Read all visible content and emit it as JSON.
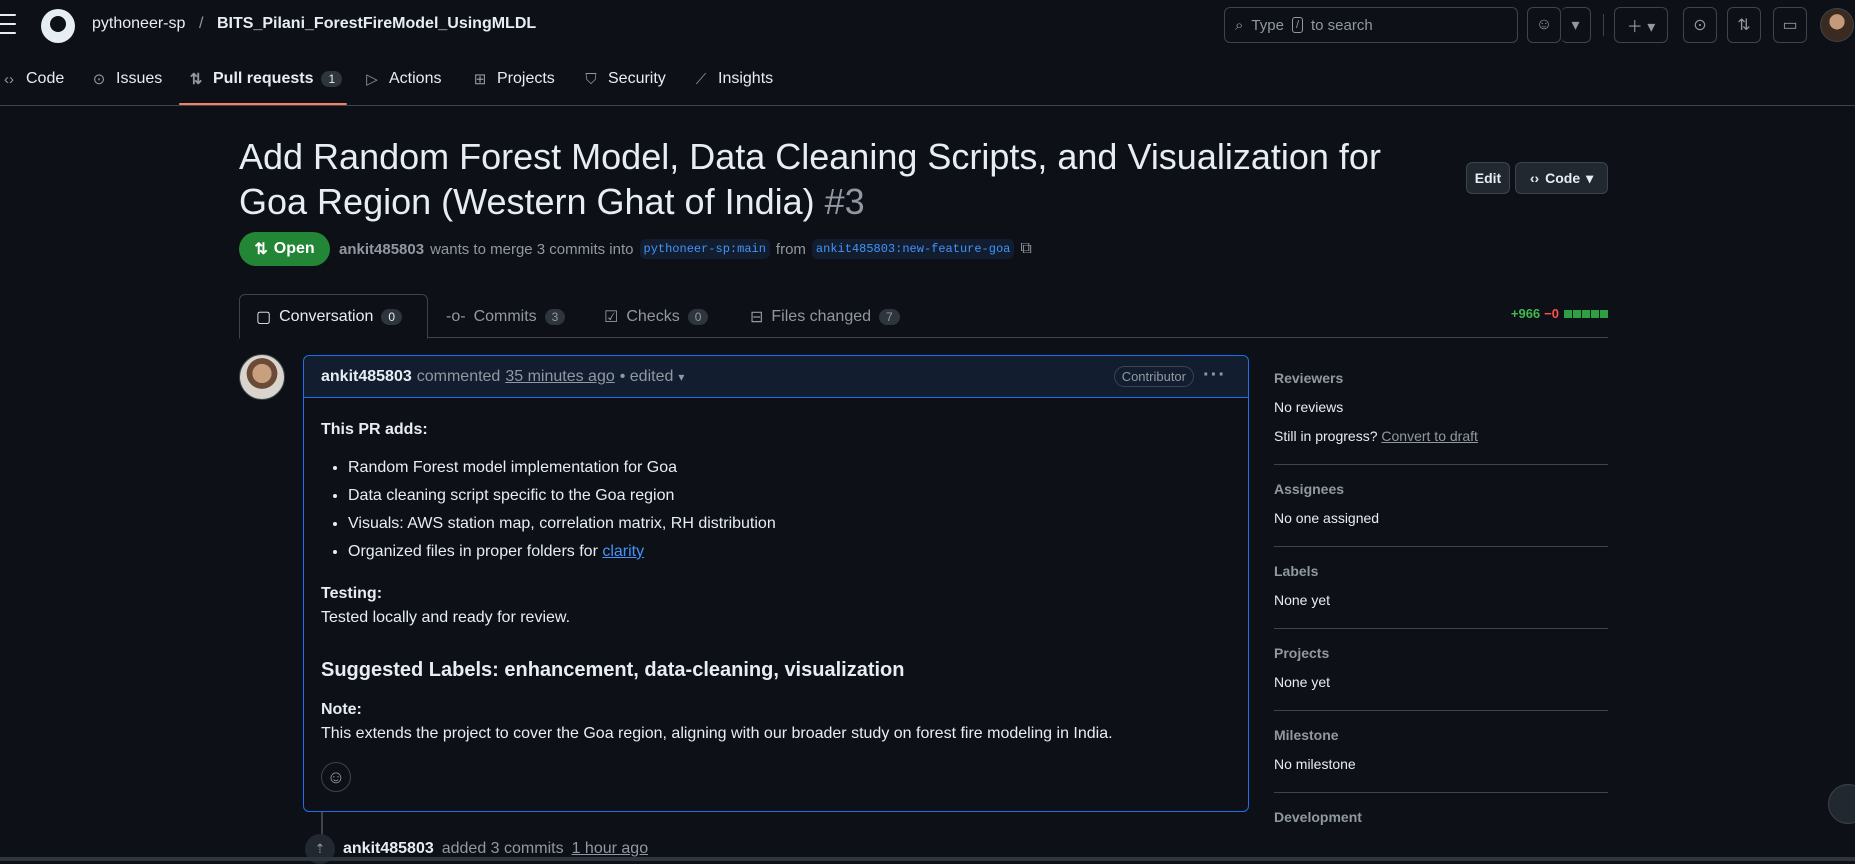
{
  "header": {
    "owner": "pythoneer-sp",
    "separator": "/",
    "repo": "BITS_Pilani_ForestFireModel_UsingMLDL",
    "search_prefix": "Type",
    "search_key": "/",
    "search_suffix": "to search"
  },
  "repo_nav": {
    "items": [
      {
        "label": "Code",
        "icon": "code-icon"
      },
      {
        "label": "Issues",
        "icon": "issue-icon"
      },
      {
        "label": "Pull requests",
        "icon": "pull-request-icon",
        "count": "1",
        "active": true
      },
      {
        "label": "Actions",
        "icon": "play-icon"
      },
      {
        "label": "Projects",
        "icon": "table-icon"
      },
      {
        "label": "Security",
        "icon": "shield-icon"
      },
      {
        "label": "Insights",
        "icon": "graph-icon"
      }
    ]
  },
  "pr": {
    "title": "Add Random Forest Model, Data Cleaning Scripts, and Visualization for Goa Region (Western Ghat of India)",
    "number": "#3",
    "state": "Open",
    "author": "ankit485803",
    "merge_text": "wants to merge 3 commits into",
    "base": "pythoneer-sp:main",
    "from_text": "from",
    "head": "ankit485803:new-feature-goa",
    "edit_label": "Edit",
    "code_label": "Code"
  },
  "tabs": [
    {
      "label": "Conversation",
      "count": "0",
      "icon": "comment-icon",
      "active": true
    },
    {
      "label": "Commits",
      "count": "3",
      "icon": "commit-icon"
    },
    {
      "label": "Checks",
      "count": "0",
      "icon": "checklist-icon"
    },
    {
      "label": "Files changed",
      "count": "7",
      "icon": "file-diff-icon"
    }
  ],
  "diffstat": {
    "additions": "+966",
    "deletions": "−0"
  },
  "comment": {
    "author": "ankit485803",
    "action": "commented",
    "time": "35 minutes ago",
    "edited": "• edited",
    "badge": "Contributor",
    "intro": "This PR adds:",
    "bullets": [
      "Random Forest model implementation for Goa",
      "Data cleaning script specific to the Goa region",
      "Visuals: AWS station map, correlation matrix, RH distribution",
      "Organized files in proper folders for "
    ],
    "bullet_link": "clarity",
    "testing_label": "Testing:",
    "testing_text": "Tested locally and ready for review.",
    "labels_heading": "Suggested Labels: enhancement, data-cleaning, visualization",
    "note_label": "Note:",
    "note_text": "This extends the project to cover the Goa region, aligning with our broader study on forest fire modeling in India."
  },
  "timeline": {
    "author": "ankit485803",
    "action": "added 3 commits",
    "time": "1 hour ago"
  },
  "sidebar": {
    "reviewers": {
      "heading": "Reviewers",
      "value": "No reviews",
      "progress": "Still in progress?",
      "link": "Convert to draft"
    },
    "assignees": {
      "heading": "Assignees",
      "value": "No one assigned"
    },
    "labels": {
      "heading": "Labels",
      "value": "None yet"
    },
    "projects": {
      "heading": "Projects",
      "value": "None yet"
    },
    "milestone": {
      "heading": "Milestone",
      "value": "No milestone"
    },
    "development": {
      "heading": "Development"
    }
  }
}
